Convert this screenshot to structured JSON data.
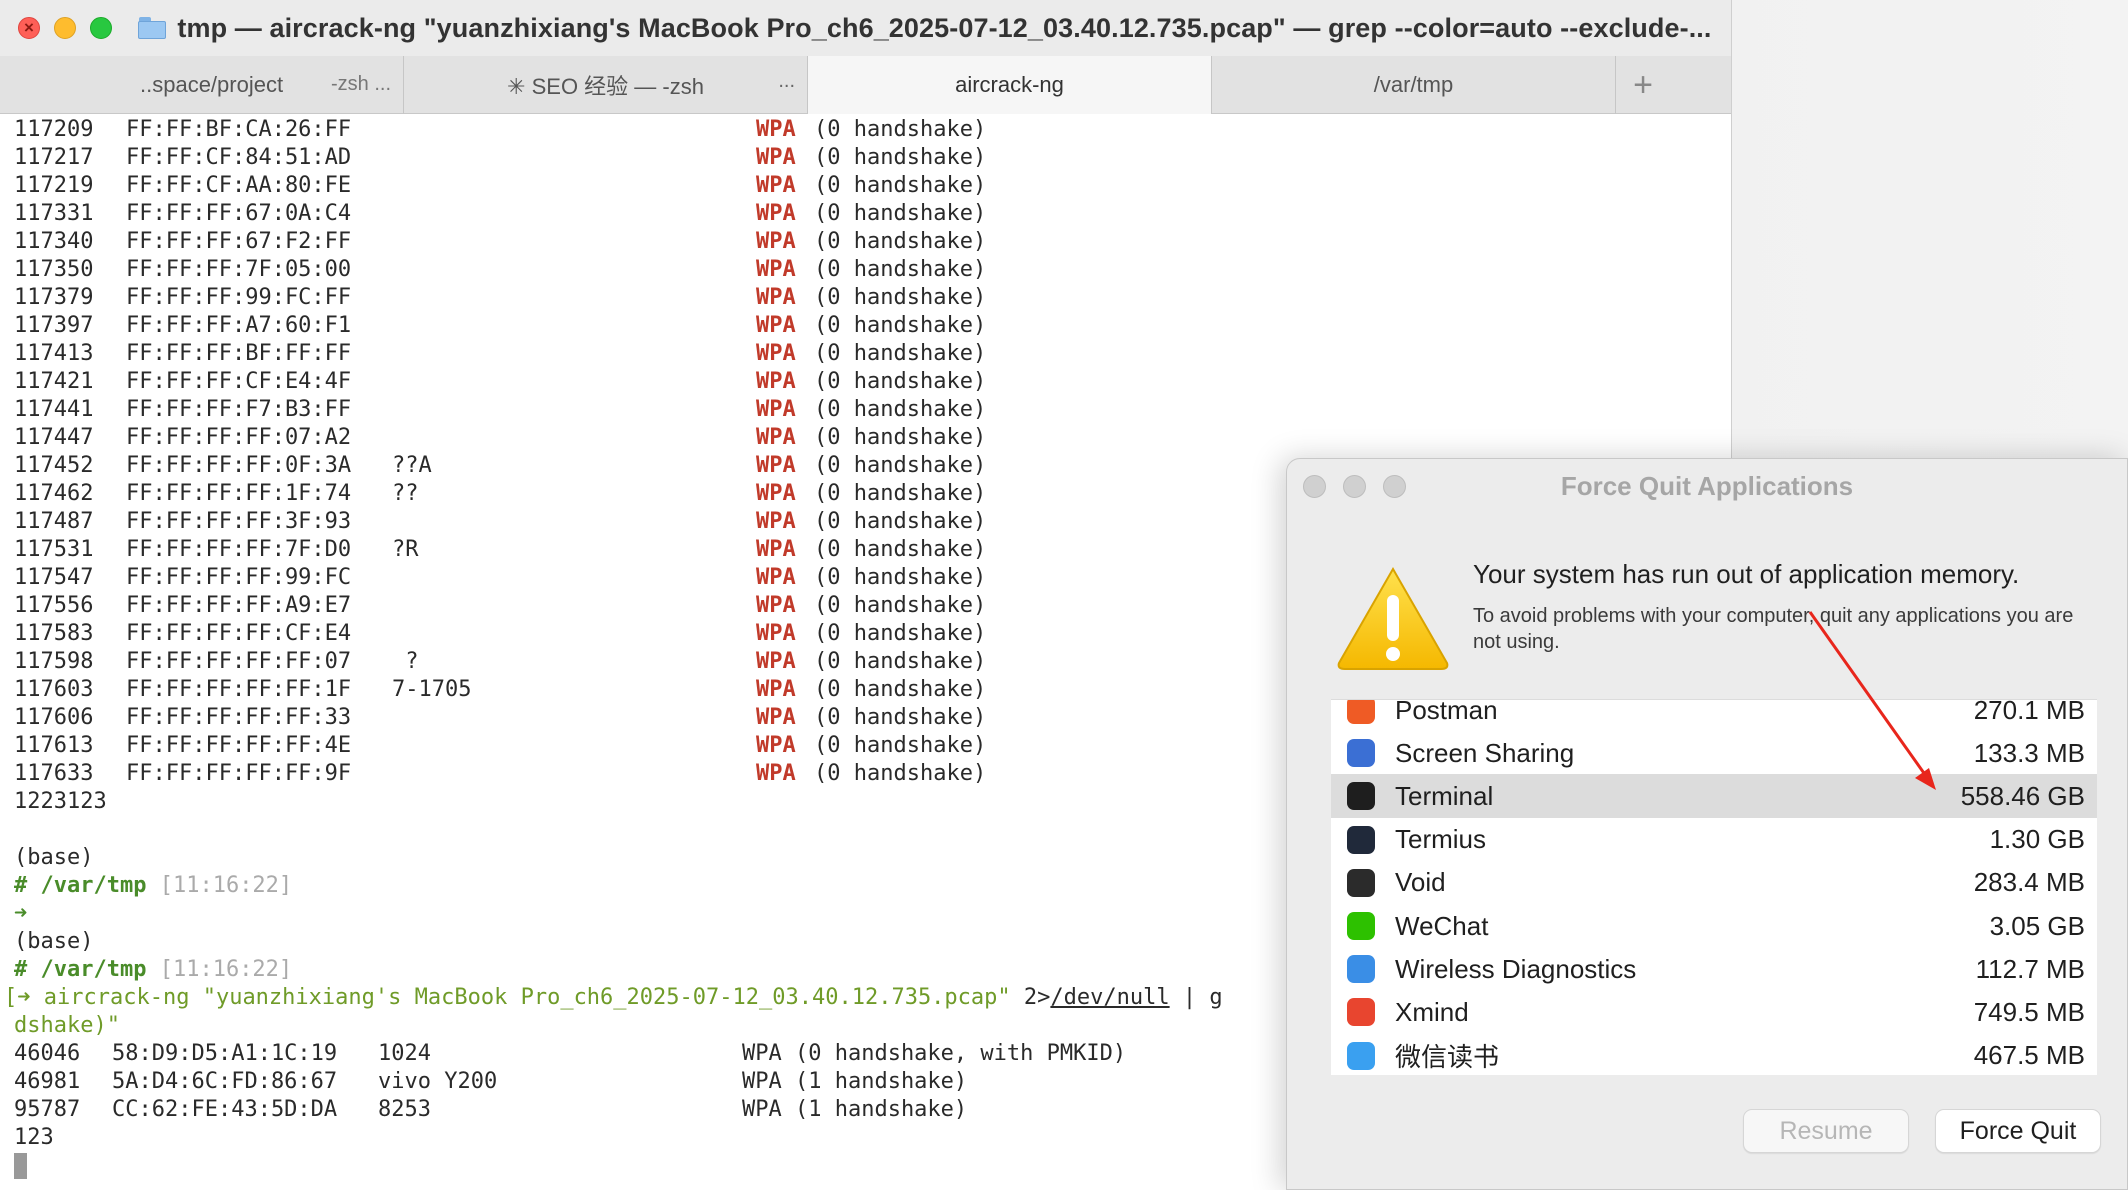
{
  "terminal": {
    "window_title": "tmp — aircrack-ng \"yuanzhixiang's MacBook Pro_ch6_2025-07-12_03.40.12.735.pcap\" — grep --color=auto --exclude-...",
    "tabs": [
      {
        "label": "..space/project",
        "sub": "-zsh ..."
      },
      {
        "label": "✳ SEO 经验 — -zsh",
        "sub": "..."
      },
      {
        "label": "aircrack-ng",
        "sub": ""
      },
      {
        "label": "/var/tmp",
        "sub": ""
      }
    ],
    "new_tab_label": "+",
    "networks": [
      {
        "id": "117209",
        "bssid": "FF:FF:BF:CA:26:FF",
        "essid": "",
        "enc": "WPA",
        "hs": "(0 handshake)"
      },
      {
        "id": "117217",
        "bssid": "FF:FF:CF:84:51:AD",
        "essid": "",
        "enc": "WPA",
        "hs": "(0 handshake)"
      },
      {
        "id": "117219",
        "bssid": "FF:FF:CF:AA:80:FE",
        "essid": "",
        "enc": "WPA",
        "hs": "(0 handshake)"
      },
      {
        "id": "117331",
        "bssid": "FF:FF:FF:67:0A:C4",
        "essid": "",
        "enc": "WPA",
        "hs": "(0 handshake)"
      },
      {
        "id": "117340",
        "bssid": "FF:FF:FF:67:F2:FF",
        "essid": "",
        "enc": "WPA",
        "hs": "(0 handshake)"
      },
      {
        "id": "117350",
        "bssid": "FF:FF:FF:7F:05:00",
        "essid": "",
        "enc": "WPA",
        "hs": "(0 handshake)"
      },
      {
        "id": "117379",
        "bssid": "FF:FF:FF:99:FC:FF",
        "essid": "",
        "enc": "WPA",
        "hs": "(0 handshake)"
      },
      {
        "id": "117397",
        "bssid": "FF:FF:FF:A7:60:F1",
        "essid": "",
        "enc": "WPA",
        "hs": "(0 handshake)"
      },
      {
        "id": "117413",
        "bssid": "FF:FF:FF:BF:FF:FF",
        "essid": "",
        "enc": "WPA",
        "hs": "(0 handshake)"
      },
      {
        "id": "117421",
        "bssid": "FF:FF:FF:CF:E4:4F",
        "essid": "",
        "enc": "WPA",
        "hs": "(0 handshake)"
      },
      {
        "id": "117441",
        "bssid": "FF:FF:FF:F7:B3:FF",
        "essid": "",
        "enc": "WPA",
        "hs": "(0 handshake)"
      },
      {
        "id": "117447",
        "bssid": "FF:FF:FF:FF:07:A2",
        "essid": "",
        "enc": "WPA",
        "hs": "(0 handshake)"
      },
      {
        "id": "117452",
        "bssid": "FF:FF:FF:FF:0F:3A",
        "essid": "??A",
        "enc": "WPA",
        "hs": "(0 handshake)"
      },
      {
        "id": "117462",
        "bssid": "FF:FF:FF:FF:1F:74",
        "essid": "??",
        "enc": "WPA",
        "hs": "(0 handshake)"
      },
      {
        "id": "117487",
        "bssid": "FF:FF:FF:FF:3F:93",
        "essid": "",
        "enc": "WPA",
        "hs": "(0 handshake)"
      },
      {
        "id": "117531",
        "bssid": "FF:FF:FF:FF:7F:D0",
        "essid": "?R",
        "enc": "WPA",
        "hs": "(0 handshake)"
      },
      {
        "id": "117547",
        "bssid": "FF:FF:FF:FF:99:FC",
        "essid": "",
        "enc": "WPA",
        "hs": "(0 handshake)"
      },
      {
        "id": "117556",
        "bssid": "FF:FF:FF:FF:A9:E7",
        "essid": "",
        "enc": "WPA",
        "hs": "(0 handshake)"
      },
      {
        "id": "117583",
        "bssid": "FF:FF:FF:FF:CF:E4",
        "essid": "",
        "enc": "WPA",
        "hs": "(0 handshake)"
      },
      {
        "id": "117598",
        "bssid": "FF:FF:FF:FF:FF:07",
        "essid": " ?",
        "enc": "WPA",
        "hs": "(0 handshake)"
      },
      {
        "id": "117603",
        "bssid": "FF:FF:FF:FF:FF:1F",
        "essid": "7-1705",
        "enc": "WPA",
        "hs": "(0 handshake)"
      },
      {
        "id": "117606",
        "bssid": "FF:FF:FF:FF:FF:33",
        "essid": "",
        "enc": "WPA",
        "hs": "(0 handshake)"
      },
      {
        "id": "117613",
        "bssid": "FF:FF:FF:FF:FF:4E",
        "essid": "",
        "enc": "WPA",
        "hs": "(0 handshake)"
      },
      {
        "id": "117633",
        "bssid": "FF:FF:FF:FF:FF:9F",
        "essid": "",
        "enc": "WPA",
        "hs": "(0 handshake)"
      }
    ],
    "after_list": "1223123",
    "base1": "(base)",
    "prompt1": {
      "hash": "#",
      "path": "/var/tmp",
      "time": "[11:16:22]"
    },
    "arrow1": "➜",
    "base2": "(base)",
    "prompt2": {
      "hash": "#",
      "path": "/var/tmp",
      "time": "[11:16:22]"
    },
    "command": {
      "arrow": "[➜",
      "program": "aircrack-ng",
      "arg": "\"yuanzhixiang's MacBook Pro_ch6_2025-07-12_03.40.12.735.pcap\"",
      "redirect": "2>",
      "devnull": "/dev/null",
      "pipe": " | g",
      "wrap": "dshake)\""
    },
    "results": [
      {
        "id": "46046",
        "bssid": "58:D9:D5:A1:1C:19",
        "essid": "1024",
        "info": "WPA (0 handshake, with PMKID)"
      },
      {
        "id": "46981",
        "bssid": "5A:D4:6C:FD:86:67",
        "essid": "vivo Y200",
        "info": "WPA (1 handshake)"
      },
      {
        "id": "95787",
        "bssid": "CC:62:FE:43:5D:DA",
        "essid": "8253",
        "info": "WPA (1 handshake)"
      }
    ],
    "last_line": "123"
  },
  "force_quit": {
    "title": "Force Quit Applications",
    "heading": "Your system has run out of application memory.",
    "subtext": "To avoid problems with your computer, quit any applications you are not using.",
    "apps": [
      {
        "name": "Postman",
        "memory": "270.1 MB",
        "icon": "postman-icon",
        "color": "#ef5b25"
      },
      {
        "name": "Screen Sharing",
        "memory": "133.3 MB",
        "icon": "screen-sharing-icon",
        "color": "#3b6fd4"
      },
      {
        "name": "Terminal",
        "memory": "558.46 GB",
        "icon": "terminal-icon",
        "color": "#1e1e1e",
        "selected": true
      },
      {
        "name": "Termius",
        "memory": "1.30 GB",
        "icon": "termius-icon",
        "color": "#20293a"
      },
      {
        "name": "Void",
        "memory": "283.4 MB",
        "icon": "void-icon",
        "color": "#2b2b2b"
      },
      {
        "name": "WeChat",
        "memory": "3.05 GB",
        "icon": "wechat-icon",
        "color": "#2dc100"
      },
      {
        "name": "Wireless Diagnostics",
        "memory": "112.7 MB",
        "icon": "wireless-diagnostics-icon",
        "color": "#3a8ee6"
      },
      {
        "name": "Xmind",
        "memory": "749.5 MB",
        "icon": "xmind-icon",
        "color": "#e8452f"
      },
      {
        "name": "微信读书",
        "memory": "467.5 MB",
        "icon": "weread-icon",
        "color": "#3aa0f0"
      }
    ],
    "resume_label": "Resume",
    "force_quit_label": "Force Quit"
  },
  "colors": {
    "wpa_red": "#c13a2a",
    "prompt_green": "#4a8c2a",
    "annotation_arrow": "#e8261c"
  }
}
